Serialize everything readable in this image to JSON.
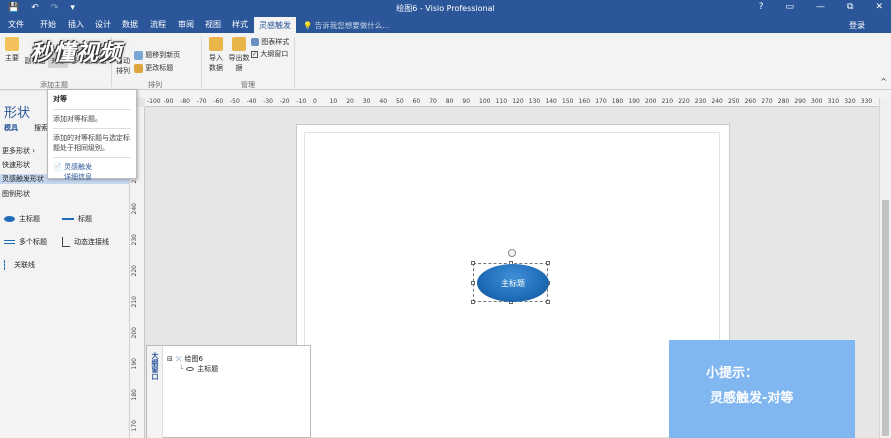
{
  "app": {
    "title": "绘图6 - Visio Professional",
    "login": "登录",
    "tell_me": "告诉我您想要做什么...",
    "quick_access": [
      "💾",
      "↶",
      "↷",
      "▾"
    ],
    "window_buttons": [
      "?",
      "▭",
      "—",
      "⧉",
      "✕"
    ]
  },
  "tabs": [
    "文件",
    "开始",
    "插入",
    "设计",
    "数据",
    "流程",
    "审阅",
    "视图",
    "样式",
    "灵感触发"
  ],
  "active_tab_index": 9,
  "ribbon": {
    "buttons": {
      "main": "主要",
      "sub": "副标题",
      "equal": "对等",
      "multi_sub": "多个副标题",
      "auto": "自动",
      "arrange": "排列",
      "move_new_page": "题移到新页",
      "change_title": "更改标题",
      "import": "导入",
      "import2": "数据",
      "export": "导出数",
      "export2": "据",
      "chart_style": "图表样式",
      "outline_window": "大纲窗口"
    },
    "groups": {
      "add_topic": "添加主题",
      "arrange": "排列",
      "manage": "管理"
    },
    "outline_checked": true,
    "watermark": "秒懂视频"
  },
  "tooltip": {
    "title": "对等",
    "line1": "添加对等标题。",
    "line2": "添加的对等标题与选定标题处于相同级别。",
    "link1": "灵感触发",
    "link2": "详细信息"
  },
  "shapes_panel": {
    "heading": "形状",
    "tab1": "模具",
    "tab2": "搜索",
    "items": [
      "更多形状",
      "快速形状",
      "灵感触发形状",
      "图例形状"
    ],
    "selected_index": 2,
    "stencils": {
      "main_title": "主标题",
      "title": "标题",
      "multi_title": "多个标题",
      "dynamic_connector": "动态连接线",
      "association_line": "关联线"
    }
  },
  "ruler": {
    "h_labels": [
      "-100",
      "-90",
      "-80",
      "-70",
      "-60",
      "-50",
      "-40",
      "-30",
      "-20",
      "-10",
      "0",
      "10",
      "20",
      "30",
      "40",
      "50",
      "60",
      "70",
      "80",
      "90",
      "100",
      "110",
      "120",
      "130",
      "140",
      "150",
      "160",
      "170",
      "180",
      "190",
      "200",
      "210",
      "220",
      "230",
      "240",
      "250",
      "260",
      "270",
      "280",
      "290",
      "300",
      "310",
      "320",
      "330"
    ],
    "v_labels": [
      "270",
      "260",
      "250",
      "240",
      "230",
      "220",
      "210",
      "200",
      "190",
      "180",
      "170"
    ]
  },
  "canvas": {
    "shape_label": "主标题",
    "shape_color": "#1f6cb8"
  },
  "outline_window": {
    "caption": "大纲窗口",
    "root": "绘图6",
    "child": "主标题"
  },
  "tip": {
    "line1": "小提示：",
    "line2": "灵感触发-对等",
    "color": "#81b7f0"
  }
}
